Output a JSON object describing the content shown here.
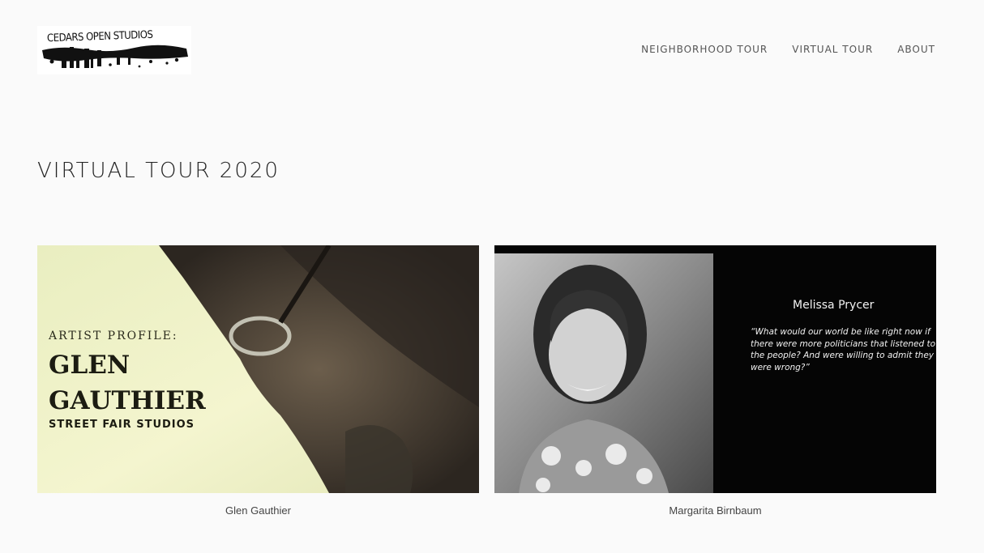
{
  "header": {
    "logo_text": "CEDARS OPEN STUDIOS",
    "nav": [
      {
        "label": "NEIGHBORHOOD TOUR"
      },
      {
        "label": "VIRTUAL TOUR"
      },
      {
        "label": "ABOUT"
      }
    ]
  },
  "main": {
    "title": "VIRTUAL TOUR 2020",
    "gallery": [
      {
        "caption": "Glen Gauthier",
        "thumb_overline": "ARTIST PROFILE:",
        "thumb_name_line1": "GLEN",
        "thumb_name_line2": "GAUTHIER",
        "thumb_subtitle": "STREET FAIR STUDIOS"
      },
      {
        "caption": "Margarita Birnbaum",
        "thumb_name": "Melissa Prycer",
        "thumb_quote_lines": [
          "“What would our world be like right now if",
          "there were more politicians that listened to",
          "the people? And were willing to admit they",
          "were wrong?”"
        ]
      }
    ]
  },
  "colors": {
    "background": "#fafafa",
    "nav_text": "#555555",
    "title_text": "#222222"
  },
  "icons": [
    "cedars-open-studios-logo"
  ]
}
